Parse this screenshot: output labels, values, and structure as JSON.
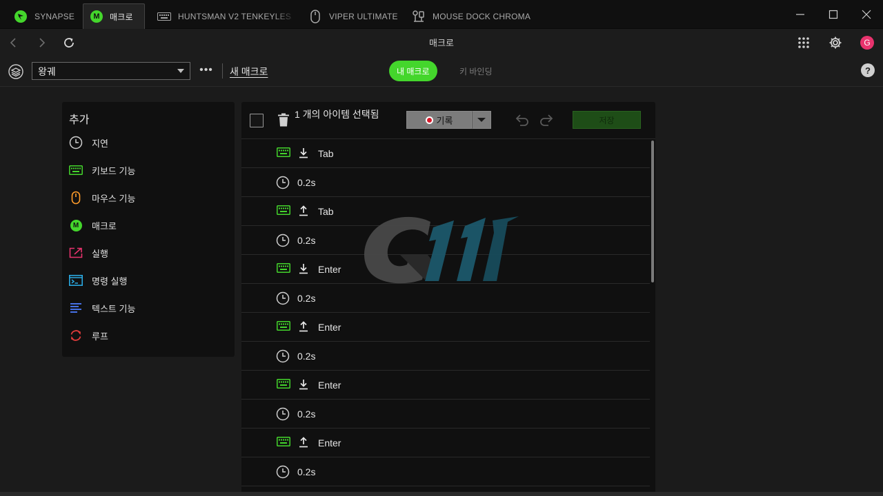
{
  "titlebar": {
    "tabs": [
      {
        "label": "SYNAPSE",
        "icon": "razer-logo-icon"
      },
      {
        "label": "매크로",
        "icon": "macro-m-icon",
        "active": true,
        "badge": "M"
      },
      {
        "label": "HUNTSMAN V2 TENKEYLESS",
        "icon": "keyboard-icon"
      },
      {
        "label": "VIPER ULTIMATE",
        "icon": "mouse-icon"
      },
      {
        "label": "MOUSE DOCK CHROMA",
        "icon": "dock-icon"
      }
    ]
  },
  "navbar": {
    "title": "매크로",
    "avatar_letter": "G"
  },
  "toolbar": {
    "profile_value": "왕궤",
    "more": "•••",
    "new_macro": "새 매크로",
    "tab_my_macros": "내 매크로",
    "tab_key_binding": "키 바인딩",
    "help": "?"
  },
  "add_panel": {
    "title": "추가",
    "items": [
      {
        "label": "지연",
        "icon": "clock-icon"
      },
      {
        "label": "키보드 기능",
        "icon": "keyboard-icon"
      },
      {
        "label": "마우스 기능",
        "icon": "mouse-icon"
      },
      {
        "label": "매크로",
        "icon": "macro-icon",
        "badge": "M"
      },
      {
        "label": "실행",
        "icon": "launch-icon"
      },
      {
        "label": "명령 실행",
        "icon": "terminal-icon"
      },
      {
        "label": "텍스트 기능",
        "icon": "text-icon"
      },
      {
        "label": "루프",
        "icon": "loop-icon"
      }
    ]
  },
  "macro_panel": {
    "selection_text": "1 개의 아이템 선택됨",
    "record_label": "기록",
    "save_label": "저장",
    "rows": [
      {
        "type": "key",
        "direction": "down",
        "label": "Tab"
      },
      {
        "type": "delay",
        "label": "0.2s"
      },
      {
        "type": "key",
        "direction": "up",
        "label": "Tab"
      },
      {
        "type": "delay",
        "label": "0.2s"
      },
      {
        "type": "key",
        "direction": "down",
        "label": "Enter"
      },
      {
        "type": "delay",
        "label": "0.2s"
      },
      {
        "type": "key",
        "direction": "up",
        "label": "Enter"
      },
      {
        "type": "delay",
        "label": "0.2s"
      },
      {
        "type": "key",
        "direction": "down",
        "label": "Enter"
      },
      {
        "type": "delay",
        "label": "0.2s"
      },
      {
        "type": "key",
        "direction": "up",
        "label": "Enter"
      },
      {
        "type": "delay",
        "label": "0.2s"
      }
    ]
  },
  "colors": {
    "accent": "#44d62c",
    "avatar": "#e8336d",
    "record": "#d7192a"
  }
}
